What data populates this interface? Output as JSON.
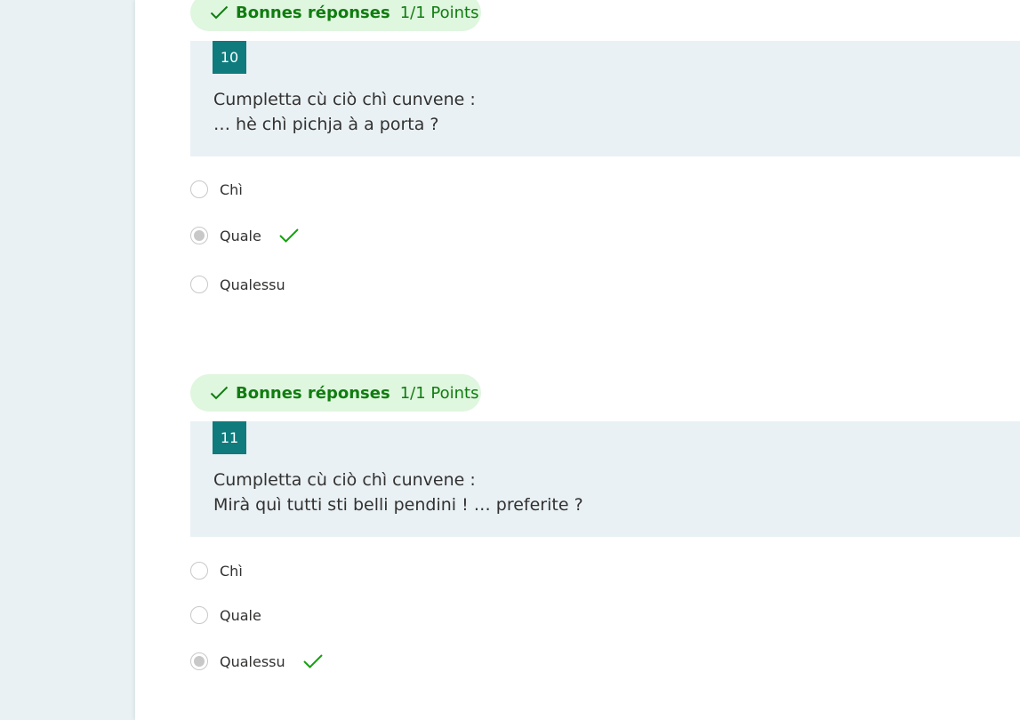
{
  "questions": [
    {
      "result_label": "Bonnes réponses",
      "points": "1/1 Points",
      "number": "10",
      "text_line1": "Cumpletta cù ciò chì cunvene :",
      "text_line2": "… hè chì pichja à a porta ?",
      "options": [
        {
          "label": "Chì",
          "selected": false,
          "correct": false
        },
        {
          "label": "Quale",
          "selected": true,
          "correct": true
        },
        {
          "label": "Qualessu",
          "selected": false,
          "correct": false
        }
      ]
    },
    {
      "result_label": "Bonnes réponses",
      "points": "1/1 Points",
      "number": "11",
      "text_line1": "Cumpletta cù ciò chì cunvene :",
      "text_line2": "Mirà quì tutti sti belli pendini ! … preferite ?",
      "options": [
        {
          "label": "Chì",
          "selected": false,
          "correct": false
        },
        {
          "label": "Quale",
          "selected": false,
          "correct": false
        },
        {
          "label": "Qualessu",
          "selected": true,
          "correct": true
        }
      ]
    }
  ],
  "colors": {
    "accent": "#0f7b7d",
    "success": "#107c10",
    "success_bg": "#dff6df",
    "card_bg": "#e9f1f4",
    "page_bg": "#e9f1f3"
  },
  "icons": {
    "result": "checkmark-icon",
    "correct": "checkmark-icon"
  }
}
